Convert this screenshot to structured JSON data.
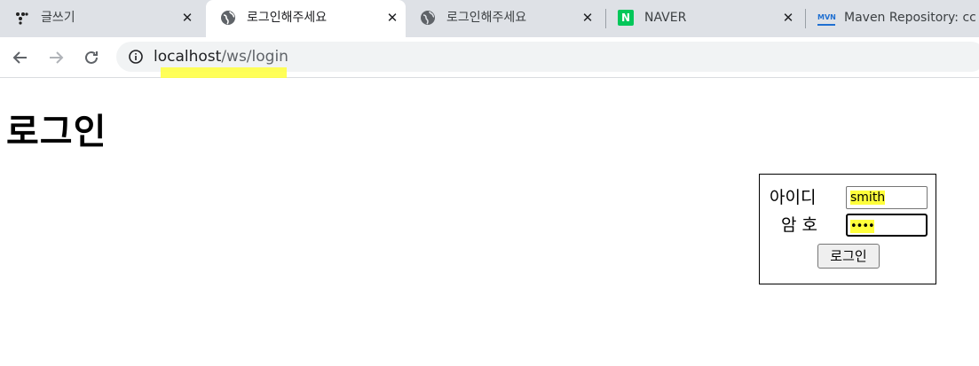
{
  "browser": {
    "tabs": [
      {
        "title": "글쓰기",
        "icon": "dots-icon",
        "active": false
      },
      {
        "title": "로그인해주세요",
        "icon": "globe-icon",
        "active": true
      },
      {
        "title": "로그인해주세요",
        "icon": "globe-icon",
        "active": false
      },
      {
        "title": "NAVER",
        "icon": "naver-icon",
        "active": false
      },
      {
        "title": "Maven Repository: cc",
        "icon": "mvn-icon",
        "active": false
      }
    ],
    "close_glyph": "✕",
    "naver_letter": "N",
    "mvn_letters": "MVN",
    "url_host": "localhost",
    "url_path": "/ws/login",
    "highlight_color": "#ffff3b"
  },
  "page": {
    "title": "로그인",
    "form": {
      "id_label": "아이디",
      "id_value": "smith",
      "pw_label": "암 호",
      "pw_value": "••••",
      "submit_label": "로그인"
    }
  }
}
